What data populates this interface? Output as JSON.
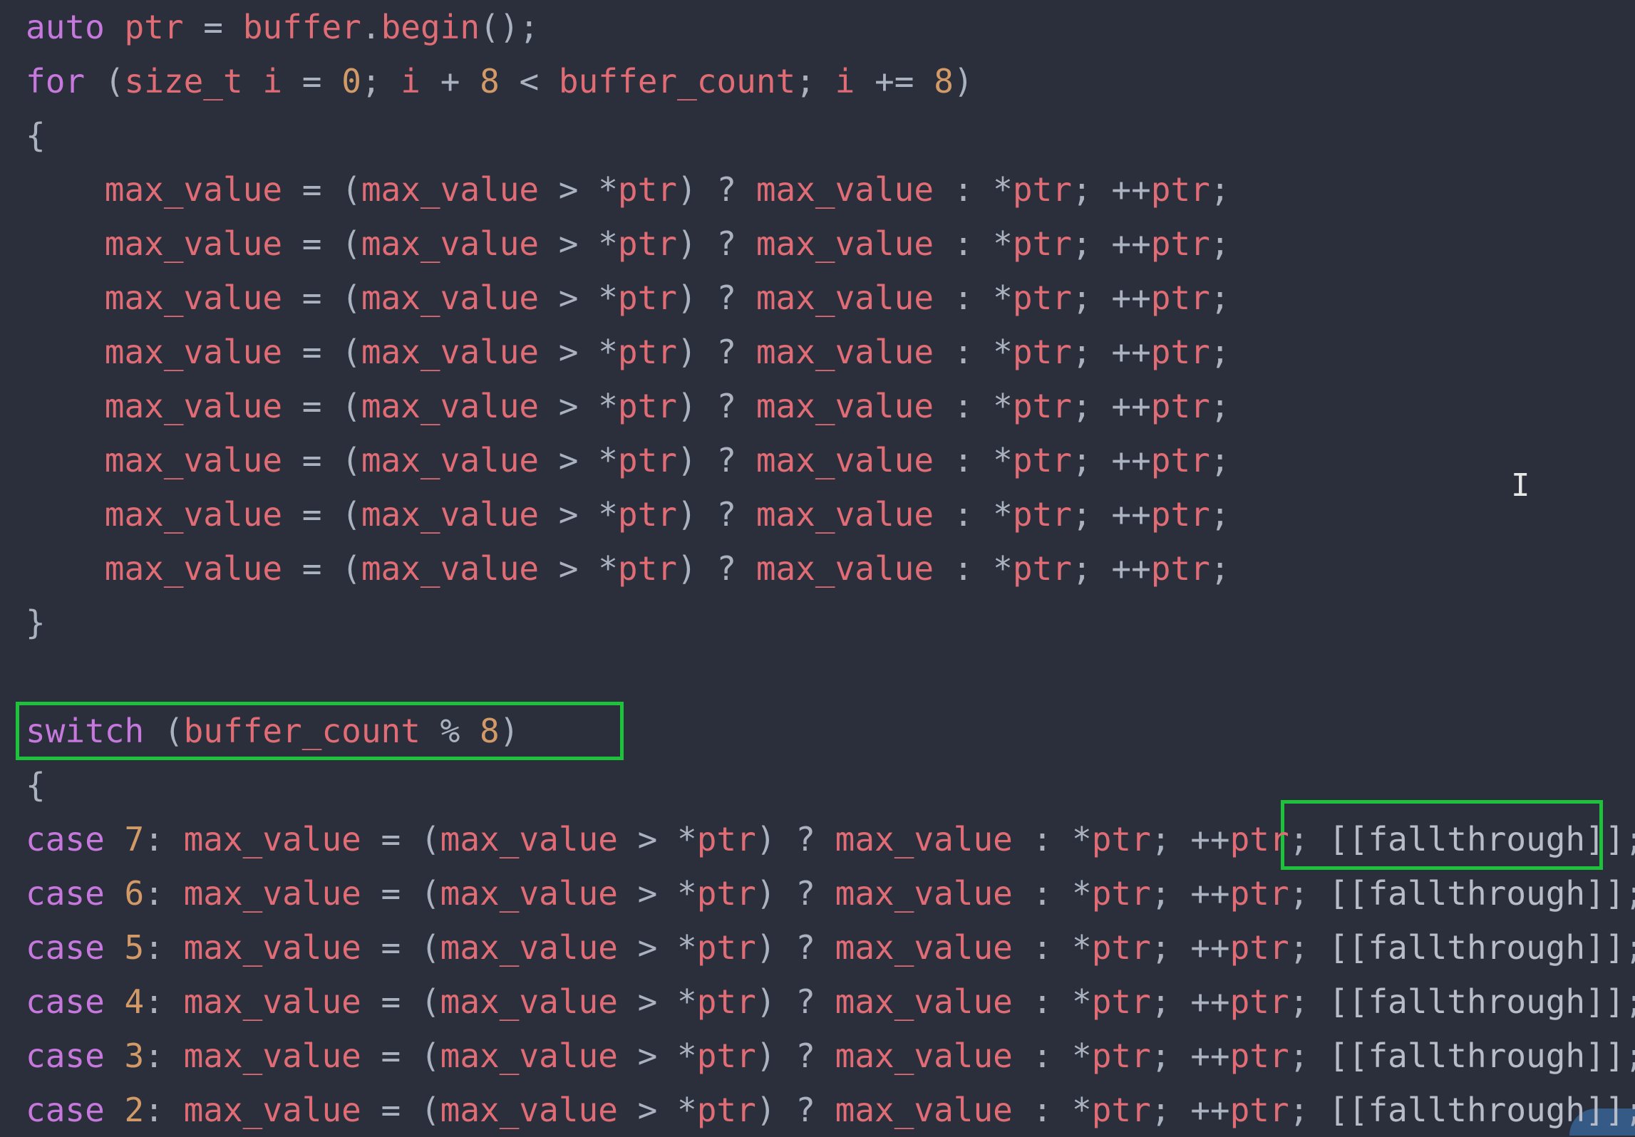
{
  "code": {
    "lines": [
      "auto ptr = buffer.begin();",
      "for (size_t i = 0; i + 8 < buffer_count; i += 8)",
      "{",
      "    max_value = (max_value > *ptr) ? max_value : *ptr; ++ptr;",
      "    max_value = (max_value > *ptr) ? max_value : *ptr; ++ptr;",
      "    max_value = (max_value > *ptr) ? max_value : *ptr; ++ptr;",
      "    max_value = (max_value > *ptr) ? max_value : *ptr; ++ptr;",
      "    max_value = (max_value > *ptr) ? max_value : *ptr; ++ptr;",
      "    max_value = (max_value > *ptr) ? max_value : *ptr; ++ptr;",
      "    max_value = (max_value > *ptr) ? max_value : *ptr; ++ptr;",
      "    max_value = (max_value > *ptr) ? max_value : *ptr; ++ptr;",
      "}",
      "",
      "switch (buffer_count % 8)",
      "{",
      "case 7: max_value = (max_value > *ptr) ? max_value : *ptr; ++ptr; [[fallthrough]];",
      "case 6: max_value = (max_value > *ptr) ? max_value : *ptr; ++ptr; [[fallthrough]];",
      "case 5: max_value = (max_value > *ptr) ? max_value : *ptr; ++ptr; [[fallthrough]];",
      "case 4: max_value = (max_value > *ptr) ? max_value : *ptr; ++ptr; [[fallthrough]];",
      "case 3: max_value = (max_value > *ptr) ? max_value : *ptr; ++ptr; [[fallthrough]];",
      "case 2: max_value = (max_value > *ptr) ? max_value : *ptr; ++ptr; [[fallthrough]];"
    ]
  },
  "highlights": [
    "switch-statement",
    "fallthrough-attribute"
  ],
  "cursor_icon": "text-cursor-icon",
  "colors": {
    "background": "#2b2e3b",
    "keyword": "#c678dd",
    "identifier": "#e06c75",
    "number": "#d19a66",
    "highlight_box": "#1dc13a"
  }
}
